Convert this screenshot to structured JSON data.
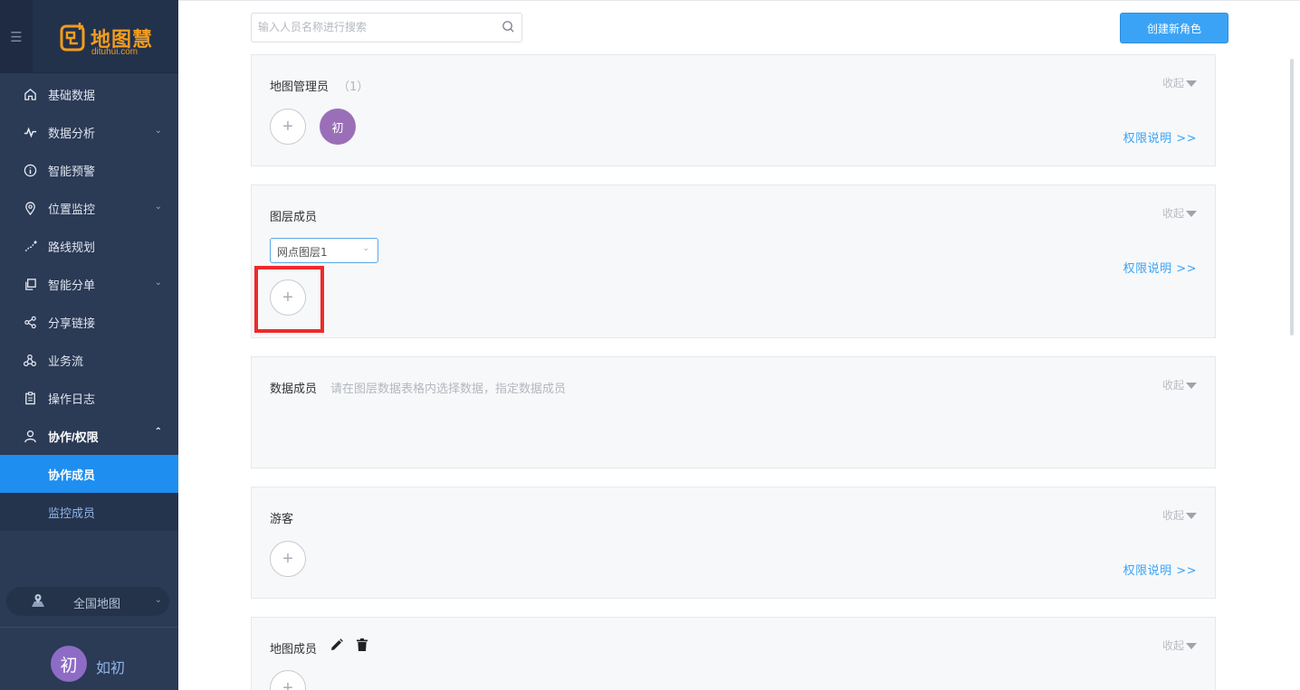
{
  "brand": {
    "name_cn": "地图慧",
    "name_en": "dituhui.com",
    "color": "#f29c1f"
  },
  "sidebar": {
    "menu_icon": "hamburger-icon",
    "items": [
      {
        "label": "基础数据",
        "icon": "home-icon"
      },
      {
        "label": "数据分析",
        "icon": "pulse-chart-icon",
        "has_children": true
      },
      {
        "label": "智能预警",
        "icon": "info-circle-icon"
      },
      {
        "label": "位置监控",
        "icon": "location-pin-icon",
        "has_children": true
      },
      {
        "label": "路线规划",
        "icon": "route-icon"
      },
      {
        "label": "智能分单",
        "icon": "copy-icon",
        "has_children": true
      },
      {
        "label": "分享链接",
        "icon": "share-icon"
      },
      {
        "label": "业务流",
        "icon": "flow-icon"
      },
      {
        "label": "操作日志",
        "icon": "clipboard-icon"
      },
      {
        "label": "协作/权限",
        "icon": "user-icon",
        "expanded": true
      }
    ],
    "sub_items": [
      {
        "label": "协作成员",
        "active": true
      },
      {
        "label": "监控成员",
        "active": false
      }
    ],
    "map_selector": {
      "label": "全国地图"
    },
    "user": {
      "avatar_text": "初",
      "name": "如初"
    }
  },
  "toolbar": {
    "search_placeholder": "输入人员名称进行搜索",
    "create_label": "创建新角色"
  },
  "sections": {
    "admin": {
      "title": "地图管理员",
      "count": "（1）",
      "collapse": "收起",
      "permission_link": "权限说明 >>",
      "members": [
        {
          "avatar_text": "初",
          "color": "#9b6fb8"
        }
      ]
    },
    "layer": {
      "title": "图层成员",
      "collapse": "收起",
      "permission_link": "权限说明 >>",
      "selected_layer": "网点图层1"
    },
    "data": {
      "title": "数据成员",
      "hint": "请在图层数据表格内选择数据，指定数据成员",
      "collapse": "收起"
    },
    "guest": {
      "title": "游客",
      "collapse": "收起",
      "permission_link": "权限说明 >>"
    },
    "map": {
      "title": "地图成员",
      "collapse": "收起"
    }
  },
  "colors": {
    "sidebar_bg": "#2b3a55",
    "active_blue": "#1e8ef0",
    "link_blue": "#3ba3f5",
    "highlight_red": "#ee2a2a"
  }
}
